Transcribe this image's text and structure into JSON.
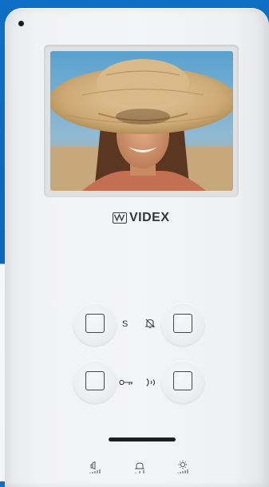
{
  "brand": {
    "name": "VIDEX"
  },
  "buttons": [
    {
      "id": "top-left"
    },
    {
      "id": "top-right"
    },
    {
      "id": "bottom-left"
    },
    {
      "id": "bottom-right"
    }
  ],
  "labels": {
    "s_label": "S",
    "key_label": "0─┬"
  },
  "icons": [
    "bell-off-icon",
    "key-icon",
    "audio-icon",
    "speaker-volume-icon",
    "bell-volume-icon",
    "brightness-icon"
  ],
  "colors": {
    "background_blue": "#0c66ba",
    "device": "#f1f2f3",
    "handle": "#1e1f20"
  }
}
